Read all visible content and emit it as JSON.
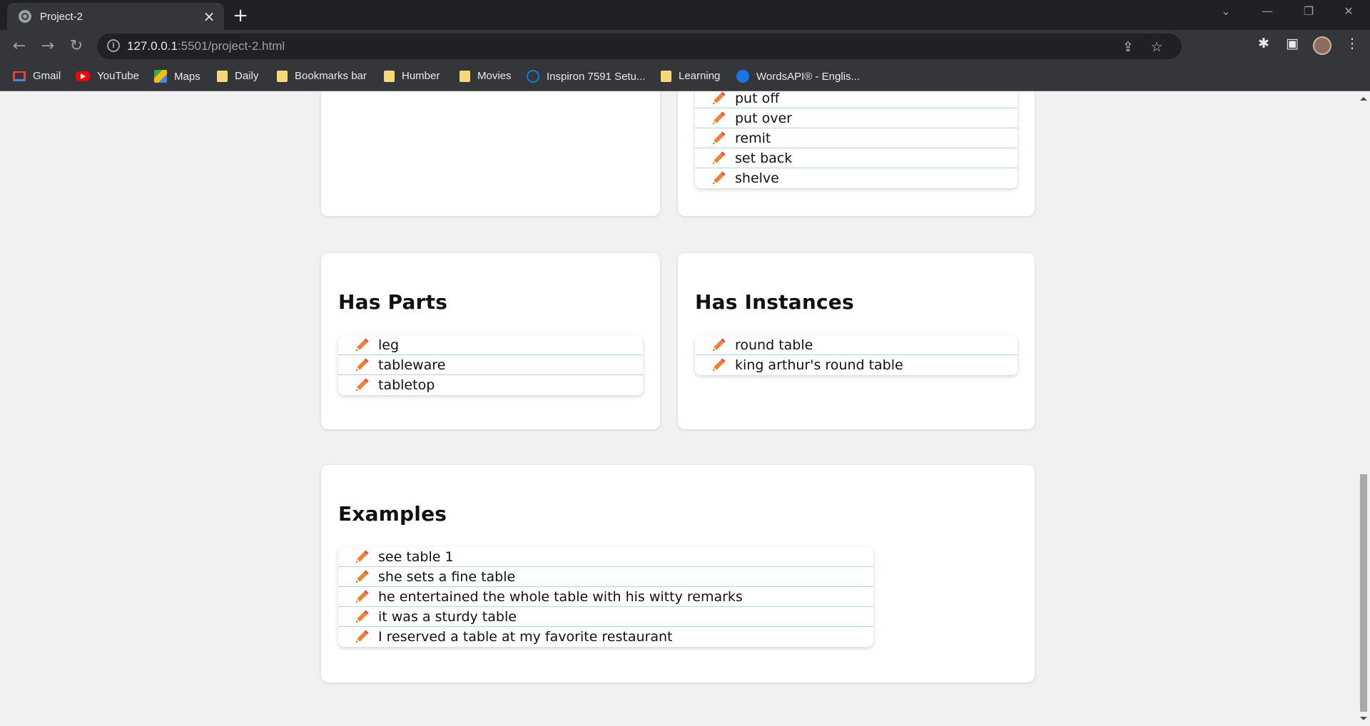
{
  "browser": {
    "tab_title": "Project-2",
    "url_host": "127.0.0.1",
    "url_rest": ":5501/project-2.html",
    "bookmarks": [
      {
        "label": "Gmail",
        "icon": "gmail-icon"
      },
      {
        "label": "YouTube",
        "icon": "youtube-icon"
      },
      {
        "label": "Maps",
        "icon": "maps-icon"
      },
      {
        "label": "Daily",
        "icon": "folder-icon"
      },
      {
        "label": "Bookmarks bar",
        "icon": "folder-icon"
      },
      {
        "label": "Humber",
        "icon": "folder-icon"
      },
      {
        "label": "Movies",
        "icon": "folder-icon"
      },
      {
        "label": "Inspiron 7591 Setu...",
        "icon": "dell-icon"
      },
      {
        "label": "Learning",
        "icon": "folder-icon"
      },
      {
        "label": "WordsAPI® - Englis...",
        "icon": "wordsapi-icon"
      }
    ]
  },
  "cards": {
    "top_right_list": [
      "put off",
      "put over",
      "remit",
      "set back",
      "shelve"
    ],
    "has_parts": {
      "title": "Has Parts",
      "items": [
        "leg",
        "tableware",
        "tabletop"
      ]
    },
    "has_instances": {
      "title": "Has Instances",
      "items": [
        "round table",
        "king arthur's round table"
      ]
    },
    "examples": {
      "title": "Examples",
      "items": [
        "see table 1",
        "she sets a fine table",
        "he entertained the whole table with his witty remarks",
        "it was a sturdy table",
        "I reserved a table at my favorite restaurant"
      ]
    }
  },
  "colors": {
    "list_divider": "#add8e6",
    "pencil_body": "#f4812a",
    "pencil_tip": "#e8425b"
  }
}
